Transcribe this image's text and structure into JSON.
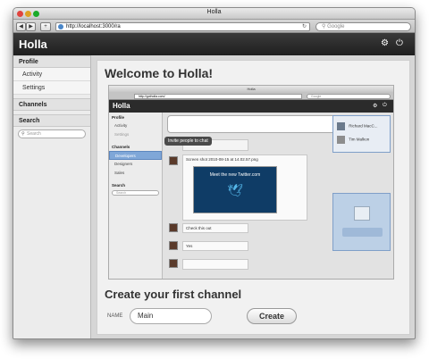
{
  "window": {
    "title": "Holla",
    "url": "http://localhost:3000/ra",
    "search_placeholder": "Google"
  },
  "app": {
    "brand": "Holla"
  },
  "sidebar": {
    "profile_heading": "Profile",
    "profile_items": [
      {
        "label": "Activity"
      },
      {
        "label": "Settings"
      }
    ],
    "channels_heading": "Channels",
    "search_heading": "Search",
    "search_placeholder": "Search"
  },
  "main": {
    "welcome": "Welcome to Holla!",
    "create_title": "Create your first channel",
    "name_label": "NAME",
    "name_value": "Main",
    "create_label": "Create"
  },
  "screenshot": {
    "window_title": "Holla",
    "url": "http://gotholla.com/",
    "search_placeholder": "Google",
    "brand": "Holla",
    "sidebar": {
      "profile": "Profile",
      "activity": "Activity",
      "settings": "Settings",
      "channels": "Channels",
      "channel_items": [
        {
          "label": "Developers"
        },
        {
          "label": "Designers"
        },
        {
          "label": "Sales"
        }
      ],
      "search": "Search",
      "search_placeholder": "Search"
    },
    "share_label": "Share",
    "tooltip": "Invite people to chat",
    "messages": [
      {
        "text": "Screen shot 2010-08-15 at 14.02.57.png"
      },
      {
        "text": "Check this out"
      },
      {
        "text": "Yes"
      }
    ],
    "preview_caption": "Meet the new Twitter.com",
    "people": [
      {
        "name": "Richard MacC..."
      },
      {
        "name": "Tim Malkon"
      }
    ]
  }
}
